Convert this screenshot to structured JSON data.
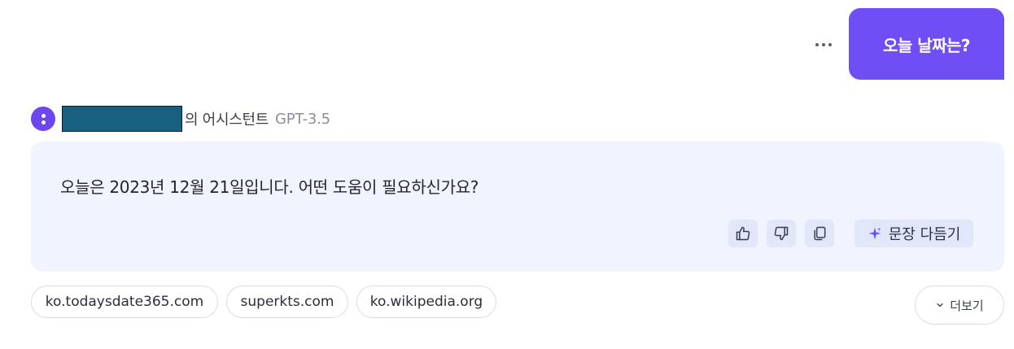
{
  "user_message": {
    "text": "오늘 날짜는?",
    "more_icon": "more-horizontal-icon"
  },
  "assistant": {
    "avatar_icon": "assistant-avatar-icon",
    "name_suffix": "의 어시스턴트",
    "model": "GPT-3.5",
    "answer": "오늘은 2023년 12월 21일입니다. 어떤 도움이 필요하신가요?",
    "actions": {
      "like_icon": "thumbs-up-icon",
      "dislike_icon": "thumbs-down-icon",
      "copy_icon": "copy-icon",
      "polish_icon": "sparkle-icon",
      "polish_label": "문장 다듬기"
    }
  },
  "sources": [
    "ko.todaysdate365.com",
    "superkts.com",
    "ko.wikipedia.org"
  ],
  "more_sources": {
    "label": "더보기",
    "icon": "chevron-down-icon"
  },
  "colors": {
    "accent": "#6f4ef6",
    "card_bg": "#eff4fe",
    "action_bg": "#dfe7f8",
    "redacted": "#17607f"
  }
}
